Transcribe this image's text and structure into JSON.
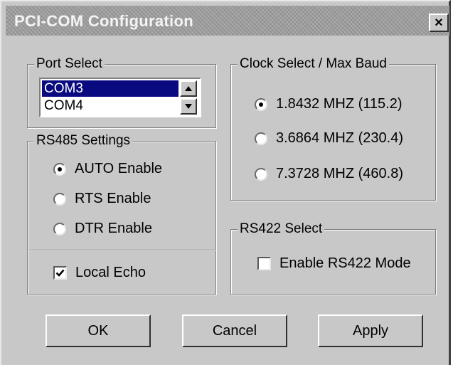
{
  "window": {
    "title": "PCI-COM Configuration",
    "close_glyph": "×"
  },
  "port_select": {
    "legend": "Port Select",
    "items": [
      "COM3",
      "COM4"
    ],
    "selected": "COM3"
  },
  "rs485": {
    "legend": "RS485 Settings",
    "options": [
      "AUTO Enable",
      "RTS Enable",
      "DTR Enable"
    ],
    "selected": "AUTO Enable",
    "local_echo_label": "Local Echo",
    "local_echo_checked": true
  },
  "clock_select": {
    "legend": "Clock Select / Max Baud",
    "options": [
      "1.8432 MHZ (115.2)",
      "3.6864 MHZ (230.4)",
      "7.3728 MHZ (460.8)"
    ],
    "selected": "1.8432 MHZ (115.2)"
  },
  "rs422": {
    "legend": "RS422 Select",
    "enable_label": "Enable RS422 Mode",
    "enable_checked": false
  },
  "buttons": {
    "ok": "OK",
    "cancel": "Cancel",
    "apply": "Apply"
  },
  "icons": {
    "close": "close-icon",
    "scroll_up": "up-arrow-icon",
    "scroll_down": "down-arrow-icon",
    "check": "checkmark-icon"
  },
  "colors": {
    "selection": "#0a0a80",
    "face": "#c8c8c8",
    "titlebar": "#9a9a9a"
  }
}
